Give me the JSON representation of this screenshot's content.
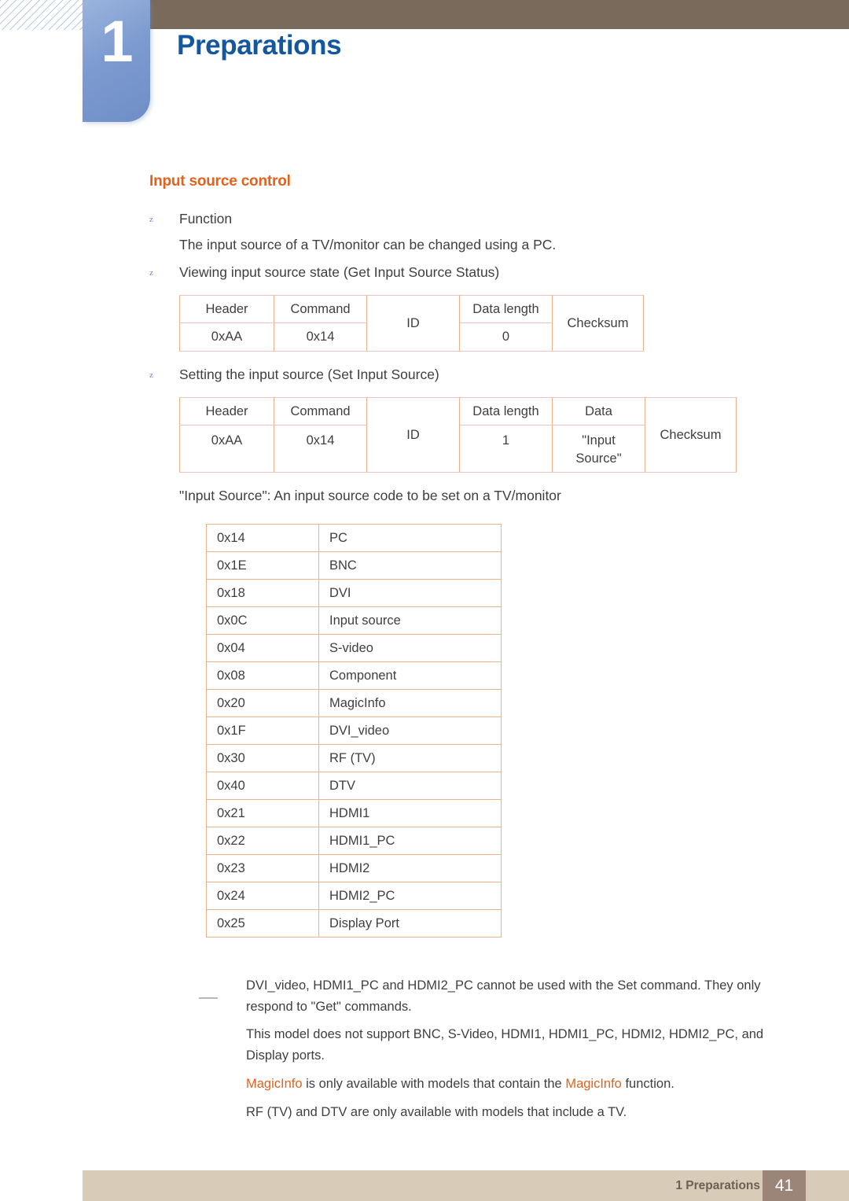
{
  "header": {
    "chapter_number": "1",
    "chapter_title": "Preparations"
  },
  "section": {
    "title": "Input source control"
  },
  "bullets": {
    "function_label": "Function",
    "function_body": "The input source of a TV/monitor can be changed using a PC.",
    "get_label": "Viewing input source state (Get Input Source Status)",
    "set_label": "Setting the input source (Set Input Source)",
    "input_source_caption": "\"Input Source\": An input source code to be set on a TV/monitor"
  },
  "get_table": {
    "headers": [
      "Header",
      "Command",
      "ID",
      "Data length",
      "Checksum"
    ],
    "values": [
      "0xAA",
      "0x14",
      "0"
    ]
  },
  "set_table": {
    "headers": [
      "Header",
      "Command",
      "ID",
      "Data length",
      "Data",
      "Checksum"
    ],
    "values": [
      "0xAA",
      "0x14",
      "1"
    ],
    "data_value_line1": "\"Input",
    "data_value_line2": "Source\""
  },
  "source_codes": [
    {
      "code": "0x14",
      "name": "PC"
    },
    {
      "code": "0x1E",
      "name": "BNC"
    },
    {
      "code": "0x18",
      "name": "DVI"
    },
    {
      "code": "0x0C",
      "name": "Input source"
    },
    {
      "code": "0x04",
      "name": "S-video"
    },
    {
      "code": "0x08",
      "name": "Component"
    },
    {
      "code": "0x20",
      "name": "MagicInfo"
    },
    {
      "code": "0x1F",
      "name": "DVI_video"
    },
    {
      "code": "0x30",
      "name": "RF (TV)"
    },
    {
      "code": "0x40",
      "name": "DTV"
    },
    {
      "code": "0x21",
      "name": "HDMI1"
    },
    {
      "code": "0x22",
      "name": "HDMI1_PC"
    },
    {
      "code": "0x23",
      "name": "HDMI2"
    },
    {
      "code": "0x24",
      "name": "HDMI2_PC"
    },
    {
      "code": "0x25",
      "name": "Display Port"
    }
  ],
  "notes": {
    "note1": "DVI_video, HDMI1_PC and HDMI2_PC cannot be used with the Set command. They only respond to \"Get\" commands.",
    "note2": "This model does not support BNC, S-Video, HDMI1, HDMI1_PC, HDMI2, HDMI2_PC, and Display ports.",
    "note3_part1": "MagicInfo",
    "note3_part2": " is only available with models that contain the ",
    "note3_part3": "MagicInfo",
    "note3_part4": " function.",
    "note4": "RF (TV) and DTV are only available with models that include a TV."
  },
  "footer": {
    "label": "1 Preparations",
    "page_number": "41"
  },
  "colors": {
    "chapter_blue": "#14579e",
    "section_orange": "#e1621d",
    "brown_bar": "#7a6a5b",
    "footer_bar": "#d8cbb8",
    "page_box": "#9a8578",
    "table_outer_border": "#b39760",
    "table_inner_border": "#efb38c"
  }
}
